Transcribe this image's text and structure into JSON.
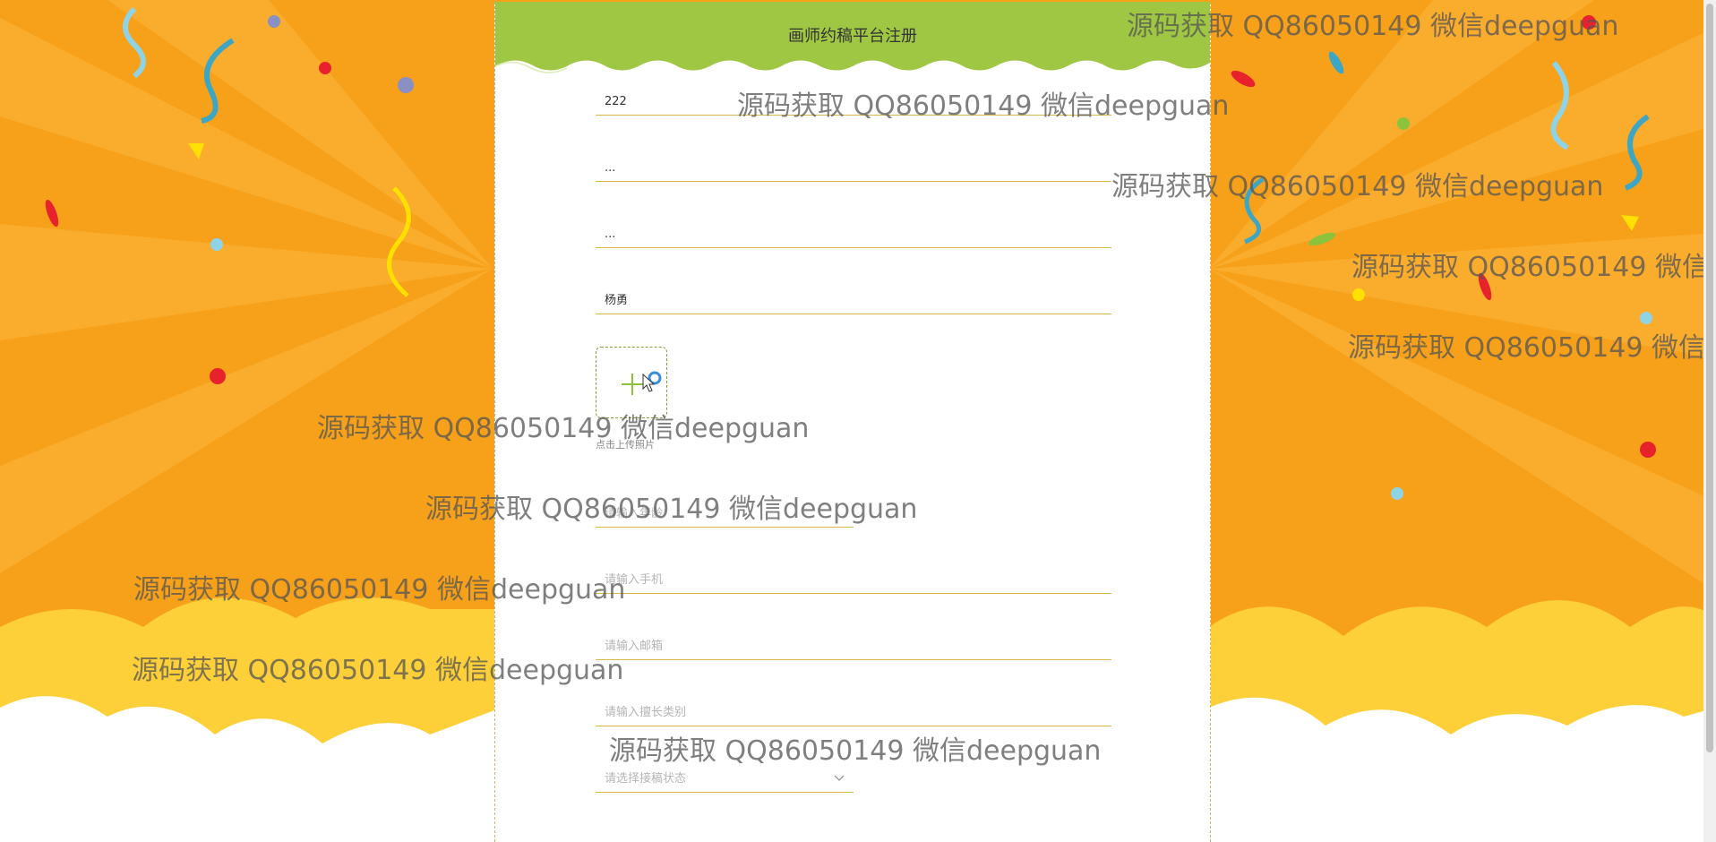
{
  "page": {
    "title": "画师约稿平台注册"
  },
  "form": {
    "fields": [
      {
        "value": "222",
        "placeholder": ""
      },
      {
        "value": "...",
        "placeholder": ""
      },
      {
        "value": "...",
        "placeholder": ""
      },
      {
        "value": "杨勇",
        "placeholder": ""
      },
      {
        "value": "",
        "placeholder": "请输入年龄"
      },
      {
        "value": "",
        "placeholder": "请输入手机"
      },
      {
        "value": "",
        "placeholder": "请输入邮箱"
      },
      {
        "value": "",
        "placeholder": "请输入擅长类别"
      },
      {
        "value": "",
        "placeholder": "请选择接稿状态"
      }
    ],
    "upload_hint": "点击上传照片"
  },
  "watermark": {
    "text": "源码获取 QQ86050149 微信deepguan"
  },
  "colors": {
    "background_orange": "#f7a11a",
    "header_green": "#a0c744",
    "field_underline": "#d9b84a"
  }
}
